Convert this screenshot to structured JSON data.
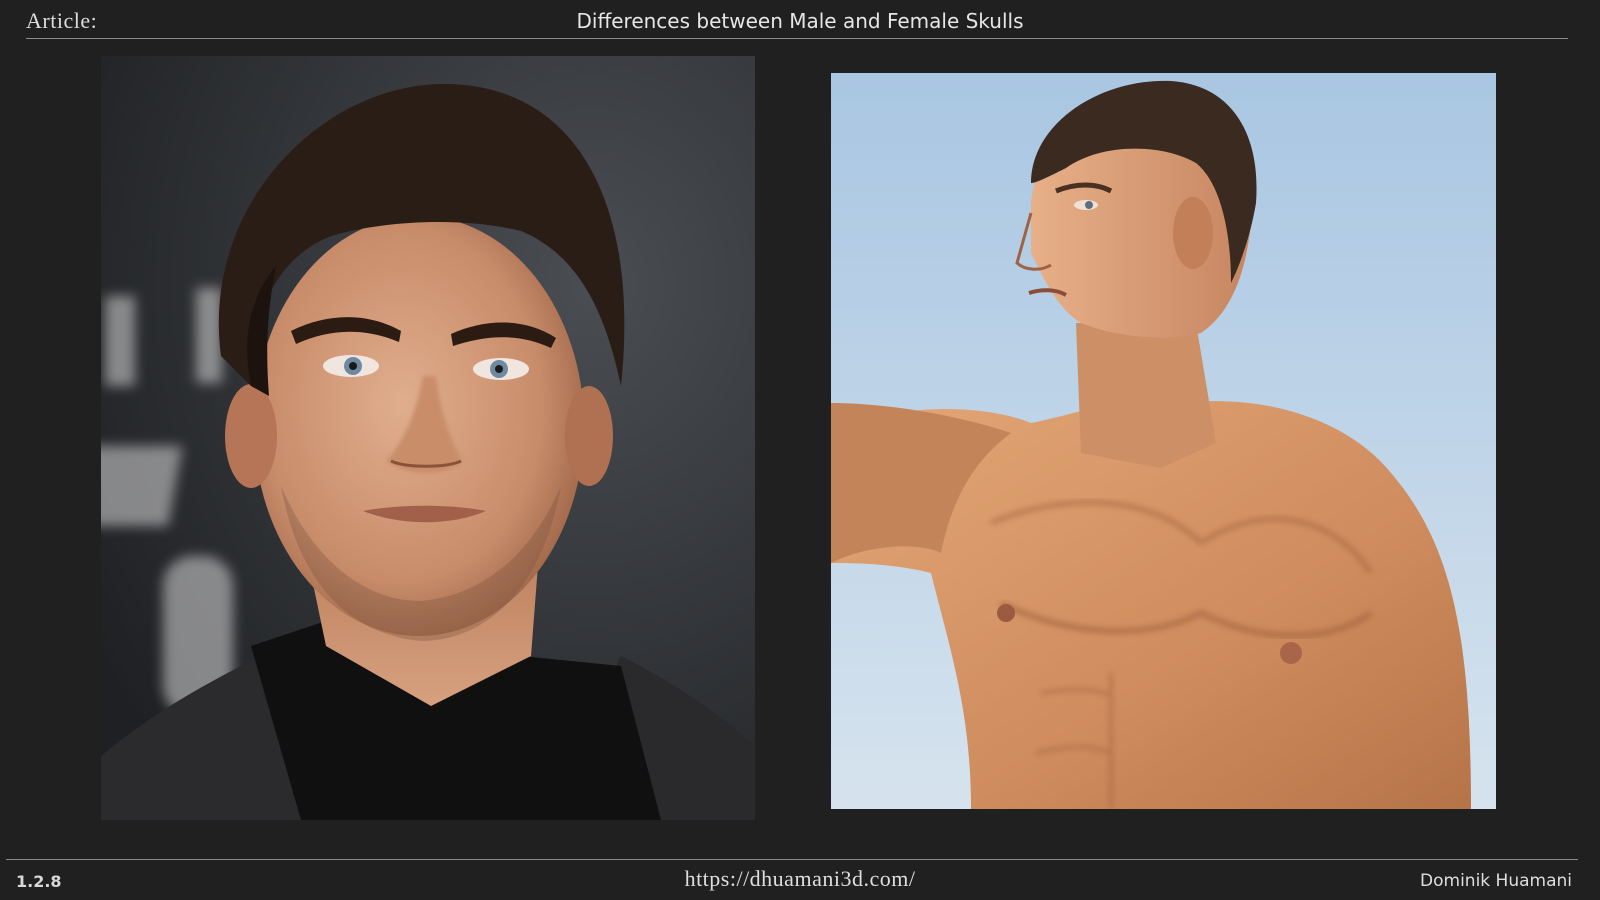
{
  "header": {
    "label": "Article:",
    "title": "Differences between Male and Female Skulls"
  },
  "footer": {
    "section_number": "1.2.8",
    "url": "https://dhuamani3d.com/",
    "author": "Dominik Huamani"
  },
  "colors": {
    "background": "#202020",
    "rule": "#8a8a8a",
    "text": "#e6e6e6"
  }
}
